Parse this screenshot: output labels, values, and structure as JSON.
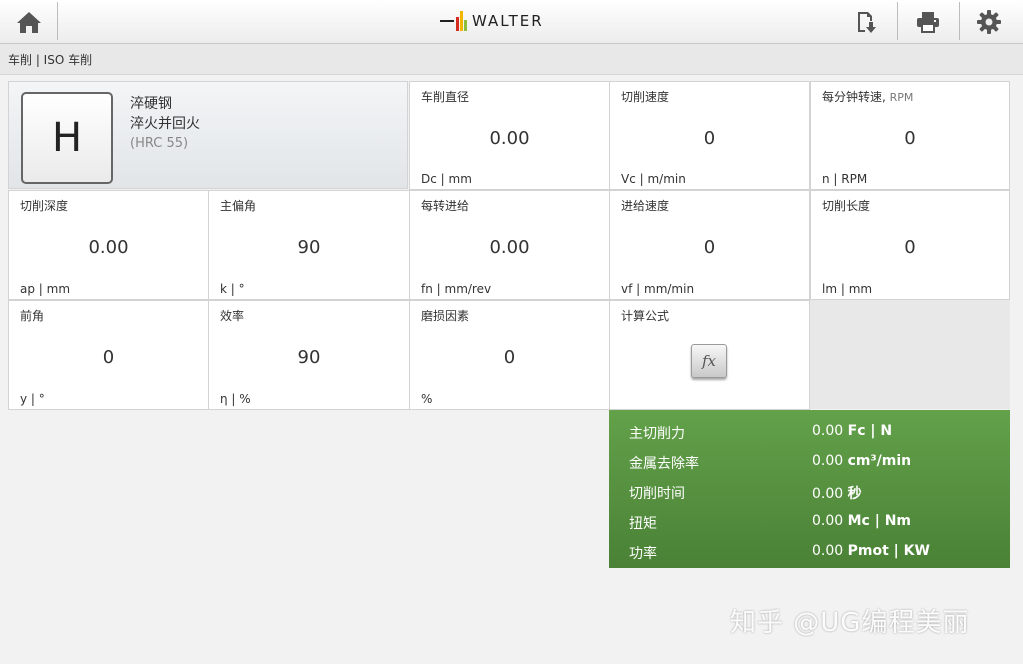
{
  "header": {
    "brand": "WALTER",
    "icons": [
      "home-icon",
      "export-icon",
      "print-icon",
      "gear-icon"
    ]
  },
  "breadcrumb": "车削 | ISO 车削",
  "material": {
    "group": "H",
    "line1": "淬硬钢",
    "line2": "淬火并回火",
    "hardness": "(HRC 55)"
  },
  "fields": {
    "dc": {
      "label": "车削直径",
      "value": "0.00",
      "unit": "Dc | mm"
    },
    "vc": {
      "label": "切削速度",
      "value": "0",
      "unit": "Vc | m/min"
    },
    "n": {
      "label": "每分钟转速",
      "label_sub": "RPM",
      "value": "0",
      "unit": "n | RPM"
    },
    "ap": {
      "label": "切削深度",
      "value": "0.00",
      "unit": "ap | mm"
    },
    "k": {
      "label": "主偏角",
      "value": "90",
      "unit": "k | °"
    },
    "fn": {
      "label": "每转进给",
      "value": "0.00",
      "unit": "fn | mm/rev"
    },
    "vf": {
      "label": "进给速度",
      "value": "0",
      "unit": "vf | mm/min"
    },
    "lm": {
      "label": "切削长度",
      "value": "0",
      "unit": "lm | mm"
    },
    "y": {
      "label": "前角",
      "value": "0",
      "unit": "y | °"
    },
    "eta": {
      "label": "效率",
      "value": "90",
      "unit": "η | %"
    },
    "wear": {
      "label": "磨损因素",
      "value": "0",
      "unit": "%"
    },
    "formula": {
      "label": "计算公式",
      "button": "fx"
    }
  },
  "results": [
    {
      "label": "主切削力",
      "value": "0.00",
      "unit": "Fc | N"
    },
    {
      "label": "金属去除率",
      "value": "0.00",
      "unit": "cm³/min"
    },
    {
      "label": "切削时间",
      "value": "0.00",
      "unit": "秒"
    },
    {
      "label": "扭矩",
      "value": "0.00",
      "unit": "Mc | Nm"
    },
    {
      "label": "功率",
      "value": "0.00",
      "unit": "Pmot | KW"
    }
  ],
  "watermark": "知乎 @UG编程美丽",
  "colors": {
    "results_green": "#5a9442",
    "logo_bars": [
      "#d52b1e",
      "#f2b600",
      "#8bbf3c",
      "#222222"
    ]
  }
}
